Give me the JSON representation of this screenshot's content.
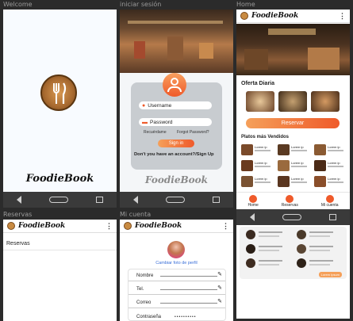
{
  "labels": {
    "welcome": "Welcome",
    "login": "iniciar sesión",
    "home": "Home",
    "reservas": "Reservas",
    "account": "Mi cuenta"
  },
  "brand": "FoodieBook",
  "login": {
    "username_label": "Username",
    "password_label": "Password",
    "remember": "Recuérdame",
    "forgot": "Forgot Password?",
    "signin": "Sign in",
    "signup": "Don't you have an account?/Sign Up"
  },
  "home": {
    "offer_title": "Oferta Diaria",
    "reserve_button": "Reservar",
    "popular_title": "Platos más Vendidos",
    "dish_title": "Lorem ip",
    "tabs": [
      "Home",
      "Reservas",
      "Mi cuenta"
    ],
    "mini_button": "Lorem Ipsum"
  },
  "reservas": {
    "heading": "Reservas"
  },
  "account": {
    "change_photo": "Cambiar foto de perfil",
    "fields": [
      "Nombre",
      "Tel.",
      "Correo",
      "Contraseña"
    ],
    "password_mask": "••••••••••"
  },
  "colors": {
    "accent": "#ef5a2a",
    "accent_light": "#f5a05a",
    "nav": "#3a3a3a"
  }
}
